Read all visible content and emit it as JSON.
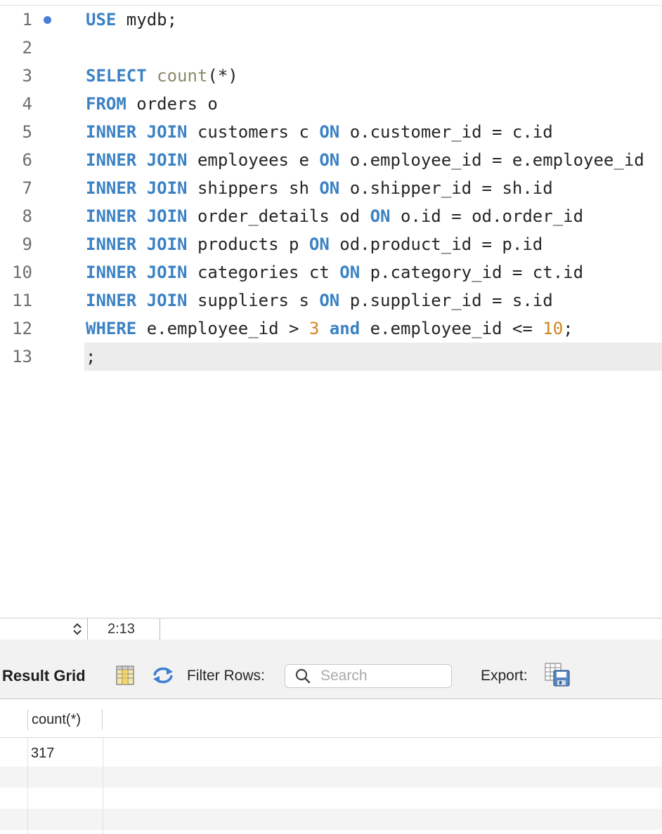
{
  "editor": {
    "lines": [
      {
        "n": "1",
        "tokens": [
          {
            "t": "USE",
            "c": "kw"
          },
          {
            "t": " mydb;",
            "c": ""
          }
        ]
      },
      {
        "n": "2",
        "tokens": []
      },
      {
        "n": "3",
        "tokens": [
          {
            "t": "SELECT",
            "c": "kw"
          },
          {
            "t": " ",
            "c": ""
          },
          {
            "t": "count",
            "c": "fn"
          },
          {
            "t": "(*)",
            "c": ""
          }
        ]
      },
      {
        "n": "4",
        "tokens": [
          {
            "t": "FROM",
            "c": "kw"
          },
          {
            "t": " orders o",
            "c": ""
          }
        ]
      },
      {
        "n": "5",
        "tokens": [
          {
            "t": "INNER JOIN",
            "c": "kw"
          },
          {
            "t": " customers c ",
            "c": ""
          },
          {
            "t": "ON",
            "c": "kw"
          },
          {
            "t": " o.customer_id = c.id",
            "c": ""
          }
        ]
      },
      {
        "n": "6",
        "tokens": [
          {
            "t": "INNER JOIN",
            "c": "kw"
          },
          {
            "t": " employees e ",
            "c": ""
          },
          {
            "t": "ON",
            "c": "kw"
          },
          {
            "t": " o.employee_id = e.employee_id",
            "c": ""
          }
        ]
      },
      {
        "n": "7",
        "tokens": [
          {
            "t": "INNER JOIN",
            "c": "kw"
          },
          {
            "t": " shippers sh ",
            "c": ""
          },
          {
            "t": "ON",
            "c": "kw"
          },
          {
            "t": " o.shipper_id = sh.id",
            "c": ""
          }
        ]
      },
      {
        "n": "8",
        "tokens": [
          {
            "t": "INNER JOIN",
            "c": "kw"
          },
          {
            "t": " order_details od ",
            "c": ""
          },
          {
            "t": "ON",
            "c": "kw"
          },
          {
            "t": " o.id = od.order_id",
            "c": ""
          }
        ]
      },
      {
        "n": "9",
        "tokens": [
          {
            "t": "INNER JOIN",
            "c": "kw"
          },
          {
            "t": " products p ",
            "c": ""
          },
          {
            "t": "ON",
            "c": "kw"
          },
          {
            "t": " od.product_id = p.id",
            "c": ""
          }
        ]
      },
      {
        "n": "10",
        "tokens": [
          {
            "t": "INNER JOIN",
            "c": "kw"
          },
          {
            "t": " categories ct ",
            "c": ""
          },
          {
            "t": "ON",
            "c": "kw"
          },
          {
            "t": " p.category_id = ct.id",
            "c": ""
          }
        ]
      },
      {
        "n": "11",
        "tokens": [
          {
            "t": "INNER JOIN",
            "c": "kw"
          },
          {
            "t": " suppliers s ",
            "c": ""
          },
          {
            "t": "ON",
            "c": "kw"
          },
          {
            "t": " p.supplier_id = s.id",
            "c": ""
          }
        ]
      },
      {
        "n": "12",
        "tokens": [
          {
            "t": "WHERE",
            "c": "kw"
          },
          {
            "t": " e.employee_id > ",
            "c": ""
          },
          {
            "t": "3",
            "c": "num"
          },
          {
            "t": " ",
            "c": ""
          },
          {
            "t": "and",
            "c": "kw"
          },
          {
            "t": " e.employee_id <= ",
            "c": ""
          },
          {
            "t": "10",
            "c": "num"
          },
          {
            "t": ";",
            "c": ""
          }
        ]
      },
      {
        "n": "13",
        "tokens": [
          {
            "t": ";",
            "c": ""
          }
        ]
      }
    ],
    "current_line": "13"
  },
  "status": {
    "cursor_position": "2:13",
    "stepper_icon": "up-down-chevron-icon"
  },
  "result_toolbar": {
    "title": "Result Grid",
    "filter_label": "Filter Rows:",
    "search_placeholder": "Search",
    "export_label": "Export:",
    "icons": [
      "grid-layout-icon",
      "refresh-icon",
      "search-icon",
      "export-icon"
    ]
  },
  "result_grid": {
    "columns": [
      "count(*)"
    ],
    "rows": [
      [
        "317"
      ]
    ]
  },
  "colors": {
    "keyword": "#3b82c4",
    "function": "#8a8a6a",
    "number": "#d3841d",
    "breakpoint_marker": "#4d7fd6"
  }
}
